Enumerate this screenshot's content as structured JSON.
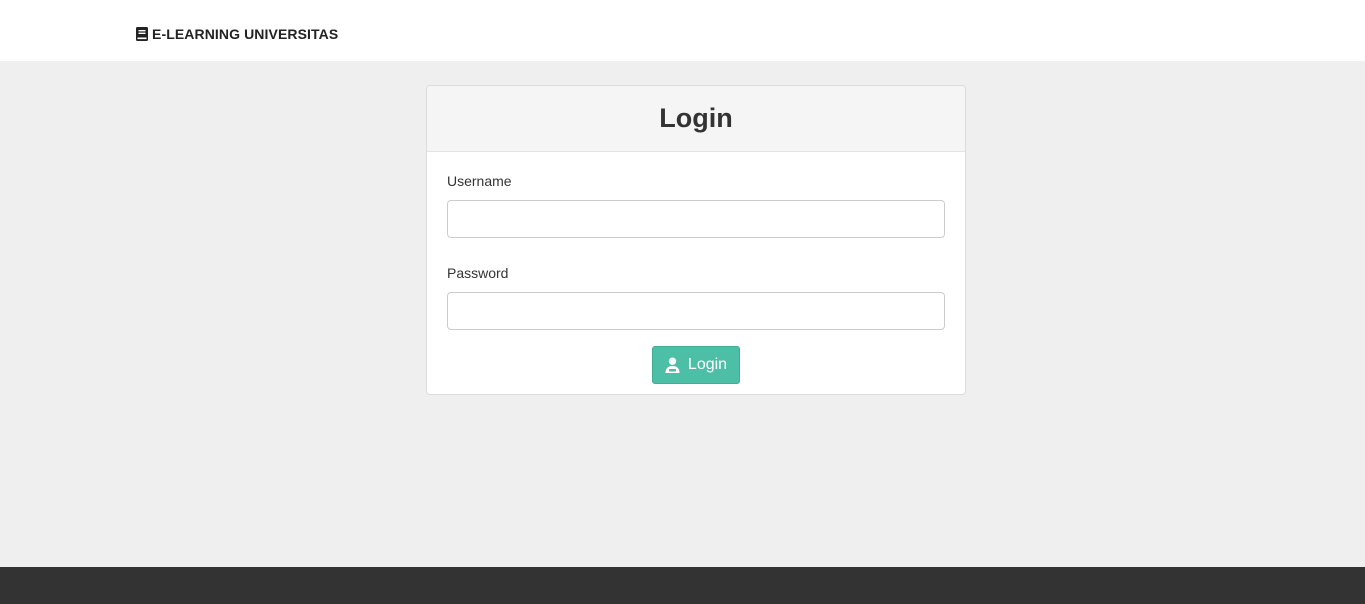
{
  "navbar": {
    "brand_icon": "book-icon",
    "brand_label": "E-LEARNING UNIVERSITAS"
  },
  "login_card": {
    "title": "Login",
    "username": {
      "label": "Username",
      "value": "",
      "placeholder": ""
    },
    "password": {
      "label": "Password",
      "value": "",
      "placeholder": ""
    },
    "submit": {
      "icon": "user-icon",
      "label": "Login"
    }
  },
  "colors": {
    "background": "#efefef",
    "navbar": "#ffffff",
    "button": "#4cbfa6",
    "footer": "#333333"
  }
}
